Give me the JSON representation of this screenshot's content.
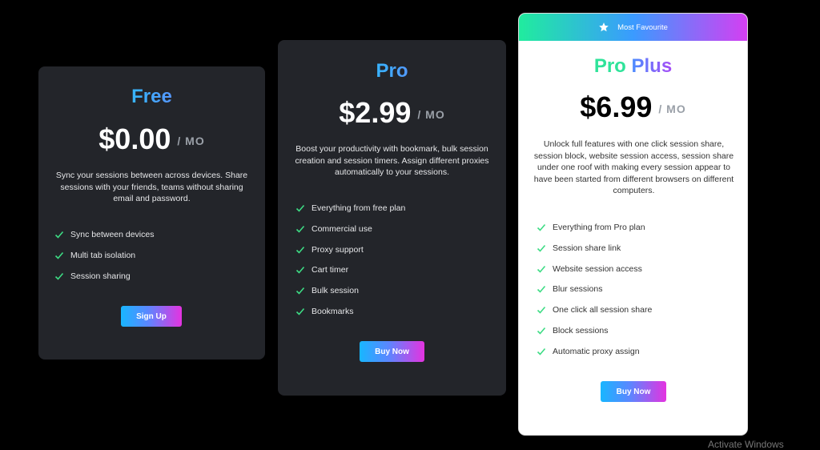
{
  "plans": [
    {
      "title": "Free",
      "price": "$0.00",
      "unit": "/ MO",
      "description": "Sync your sessions between across devices. Share sessions with your friends, teams without sharing email and password.",
      "features": [
        "Sync between devices",
        "Multi tab isolation",
        "Session sharing"
      ],
      "button": "Sign Up"
    },
    {
      "title": "Pro",
      "price": "$2.99",
      "unit": "/ MO",
      "description": "Boost your productivity with bookmark, bulk session creation and session timers. Assign different proxies automatically to your sessions.",
      "features": [
        "Everything from free plan",
        "Commercial use",
        "Proxy support",
        "Cart timer",
        "Bulk session",
        "Bookmarks"
      ],
      "button": "Buy Now"
    },
    {
      "title_part1": "Pro ",
      "title_part2": "Plus",
      "badge": "Most Favourite",
      "price": "$6.99",
      "unit": "/ MO",
      "description": "Unlock full features with one click session share, session block, website session access, session share under one roof with making every session appear to have been started from different browsers on different computers.",
      "features": [
        "Everything from Pro plan",
        "Session share link",
        "Website session access",
        "Blur sessions",
        "One click all session share",
        "Block sessions",
        "Automatic proxy assign"
      ],
      "button": "Buy Now"
    }
  ],
  "watermark": "Activate Windows",
  "colors": {
    "check": "#3ddc84",
    "card_dark": "#23252a",
    "background": "#000000"
  },
  "icons": {
    "check": "check-icon",
    "star": "star-icon"
  }
}
